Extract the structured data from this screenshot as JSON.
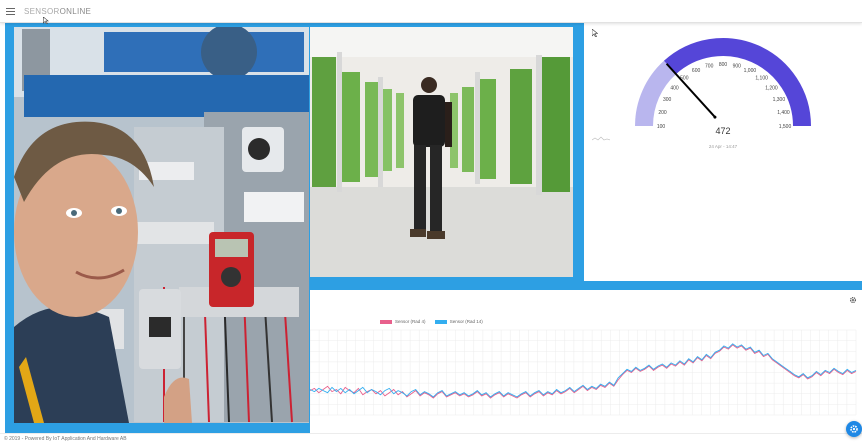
{
  "app": {
    "brand_part1": "SENSOR",
    "brand_part2": "ONLINE"
  },
  "gauge": {
    "value": "472",
    "timestamp": "24 Apr - 14:47",
    "ticks": [
      "100",
      "200",
      "300",
      "400",
      "500",
      "600",
      "700",
      "800",
      "900",
      "1,000",
      "1,100",
      "1,200",
      "1,300",
      "1,400",
      "1,500"
    ],
    "min": 100,
    "max": 1500,
    "colors": {
      "fill": "#5546d8",
      "track": "#b9b6ee",
      "needle": "#000000"
    }
  },
  "images": {
    "left_photo": "photo-technician-selfie",
    "mid_photo": "photo-vertical-farm"
  },
  "chart_data": {
    "type": "line",
    "legend": [
      {
        "name": "Sensor (Rad 4)",
        "color": "#e8608c"
      },
      {
        "name": "Sensor (Rad 14)",
        "color": "#33aef0"
      }
    ],
    "series": [
      {
        "name": "Sensor (Rad 4)",
        "color": "#e8608c",
        "values": [
          43,
          45,
          41,
          44,
          47,
          42,
          44,
          40,
          46,
          43,
          41,
          45,
          39,
          42,
          44,
          40,
          43,
          38,
          41,
          44,
          39,
          42,
          37,
          40,
          43,
          38,
          41,
          39,
          36,
          40,
          42,
          37,
          39,
          41,
          38,
          40,
          37,
          39,
          42,
          38,
          40,
          36,
          39,
          41,
          37,
          40,
          38,
          36,
          39,
          41,
          37,
          40,
          42,
          38,
          41,
          39,
          43,
          40,
          42,
          45,
          41,
          44,
          47,
          43,
          46,
          44,
          48,
          46,
          50,
          47,
          53,
          58,
          62,
          60,
          64,
          61,
          63,
          66,
          62,
          65,
          67,
          64,
          68,
          66,
          70,
          67,
          72,
          69,
          74,
          71,
          76,
          73,
          78,
          80,
          84,
          82,
          86,
          83,
          85,
          81,
          83,
          78,
          80,
          75,
          77,
          72,
          69,
          66,
          63,
          60,
          57,
          55,
          58,
          54,
          56,
          60,
          57,
          61,
          59,
          63,
          60,
          58,
          62,
          59,
          61
        ]
      },
      {
        "name": "Sensor (Rad 14)",
        "color": "#33aef0",
        "values": [
          44,
          42,
          45,
          43,
          41,
          46,
          42,
          45,
          41,
          44,
          40,
          43,
          46,
          41,
          44,
          42,
          39,
          43,
          45,
          40,
          43,
          41,
          38,
          42,
          44,
          39,
          42,
          40,
          37,
          41,
          43,
          38,
          40,
          42,
          39,
          41,
          38,
          40,
          43,
          39,
          41,
          37,
          40,
          42,
          38,
          41,
          39,
          37,
          40,
          42,
          38,
          41,
          43,
          39,
          42,
          40,
          44,
          41,
          43,
          46,
          42,
          45,
          48,
          44,
          47,
          45,
          49,
          47,
          51,
          48,
          55,
          59,
          63,
          61,
          65,
          62,
          64,
          67,
          63,
          66,
          68,
          65,
          69,
          67,
          71,
          68,
          73,
          70,
          75,
          72,
          77,
          74,
          79,
          81,
          85,
          83,
          87,
          84,
          86,
          82,
          84,
          79,
          81,
          76,
          78,
          73,
          70,
          67,
          64,
          61,
          58,
          56,
          59,
          55,
          57,
          61,
          58,
          62,
          60,
          64,
          61,
          59,
          63,
          60,
          62
        ]
      }
    ],
    "ylim": [
      20,
      100
    ]
  },
  "footer": {
    "text": "© 2019 - Powered By IoT Application And Hardware AB"
  },
  "colors": {
    "accent": "#2d9fe3",
    "fab": "#1e88e5"
  }
}
